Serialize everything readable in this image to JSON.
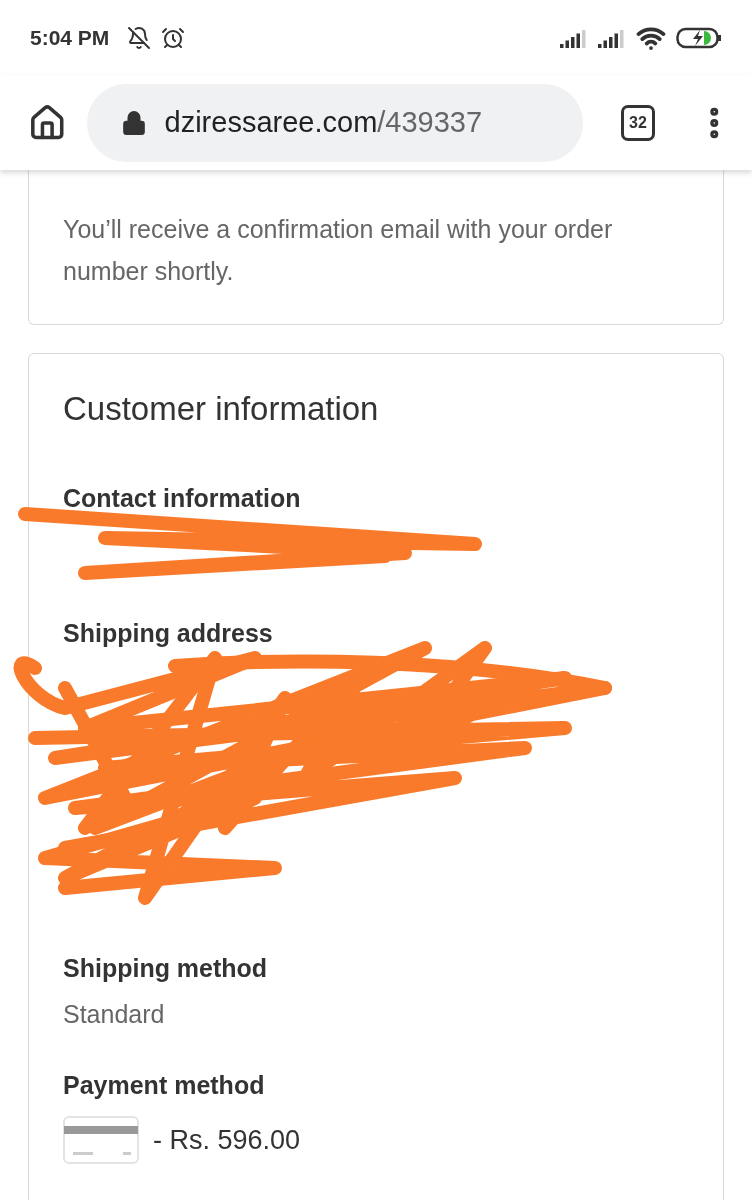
{
  "status_bar": {
    "time": "5:04 PM"
  },
  "browser": {
    "url_host": "dziressaree.com",
    "url_path": "/439337",
    "tab_count": "32"
  },
  "confirmation": {
    "text": "You’ll receive a confirmation email with your order number shortly."
  },
  "customer": {
    "title": "Customer information",
    "sections": [
      {
        "heading": "Contact information",
        "kind": "redacted"
      },
      {
        "heading": "Shipping address",
        "kind": "redacted_block"
      },
      {
        "heading": "Shipping method",
        "kind": "text",
        "value": "Standard"
      },
      {
        "heading": "Payment method",
        "kind": "payment",
        "value": "- Rs. 596.00"
      }
    ]
  }
}
